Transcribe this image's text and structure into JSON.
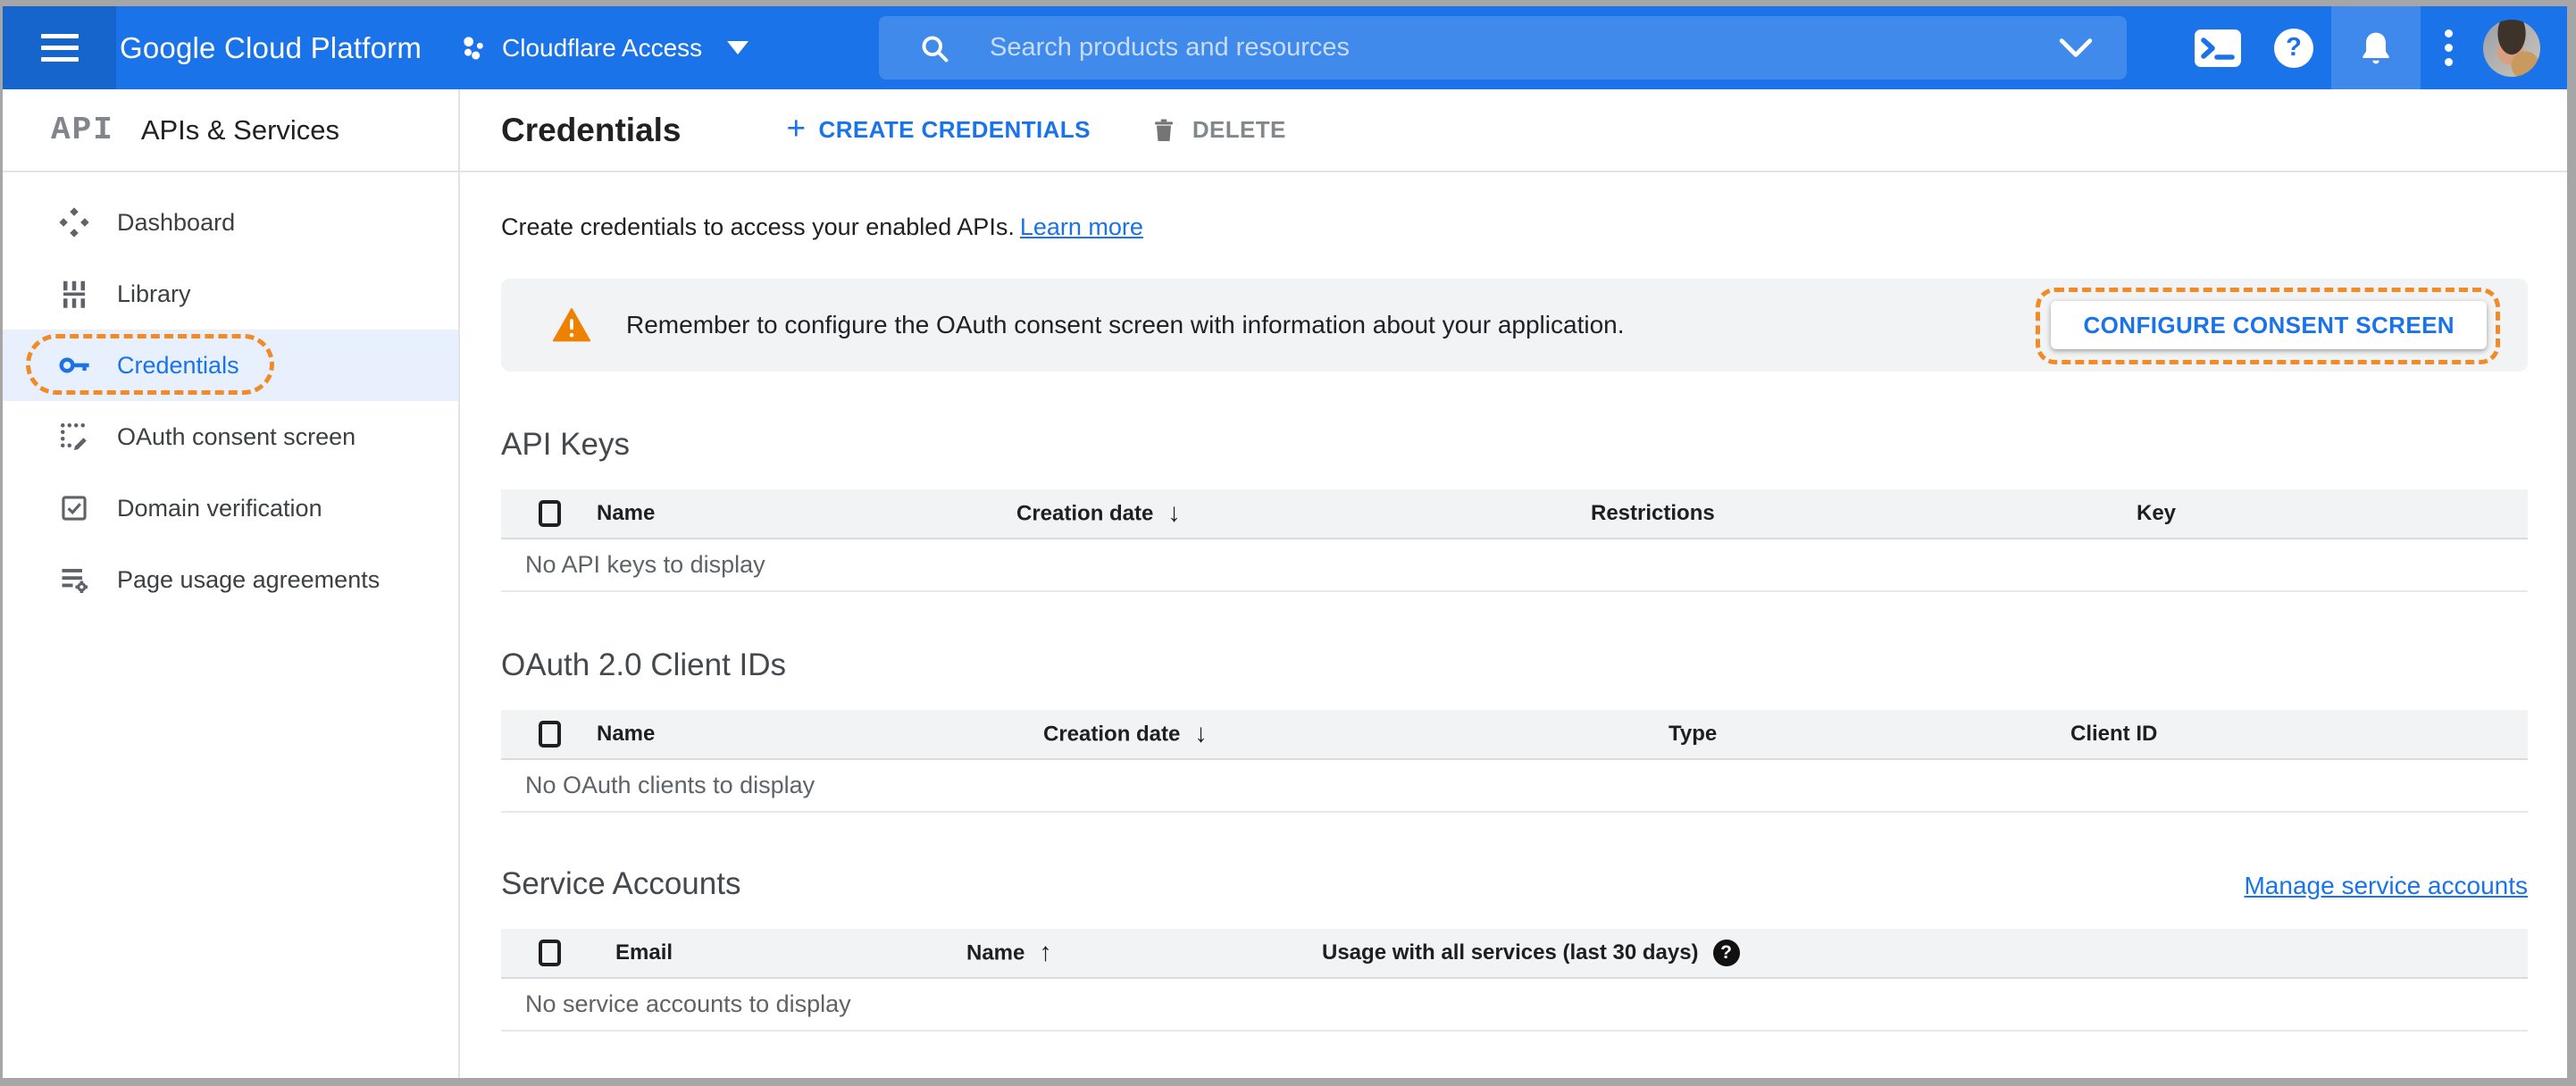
{
  "topbar": {
    "product_name": "Google Cloud Platform",
    "project_name": "Cloudflare Access",
    "search_placeholder": "Search products and resources"
  },
  "sidebar": {
    "logo_text": "API",
    "title": "APIs & Services",
    "items": [
      {
        "label": "Dashboard",
        "active": false
      },
      {
        "label": "Library",
        "active": false
      },
      {
        "label": "Credentials",
        "active": true,
        "annotated": true
      },
      {
        "label": "OAuth consent screen",
        "active": false
      },
      {
        "label": "Domain verification",
        "active": false
      },
      {
        "label": "Page usage agreements",
        "active": false
      }
    ]
  },
  "page_header": {
    "title": "Credentials",
    "create_button": "CREATE CREDENTIALS",
    "delete_button": "DELETE"
  },
  "intro": {
    "text": "Create credentials to access your enabled APIs.",
    "link": "Learn more"
  },
  "banner": {
    "message": "Remember to configure the OAuth consent screen with information about your application.",
    "button": "CONFIGURE CONSENT SCREEN"
  },
  "sections": {
    "api_keys": {
      "title": "API Keys",
      "col_name": "Name",
      "col_creation": "Creation date",
      "col_restrictions": "Restrictions",
      "col_key": "Key",
      "sort": "Creation date descending",
      "empty": "No API keys to display"
    },
    "oauth": {
      "title": "OAuth 2.0 Client IDs",
      "col_name": "Name",
      "col_creation": "Creation date",
      "col_type": "Type",
      "col_client_id": "Client ID",
      "sort": "Creation date descending",
      "empty": "No OAuth clients to display"
    },
    "service_accounts": {
      "title": "Service Accounts",
      "manage_link": "Manage service accounts",
      "col_email": "Email",
      "col_name": "Name",
      "col_usage": "Usage with all services (last 30 days)",
      "sort": "Name ascending",
      "empty": "No service accounts to display"
    }
  },
  "icons": {
    "plus": "+",
    "sort_desc": "↓",
    "sort_asc": "↑",
    "question_mark": "?"
  },
  "colors": {
    "topbar_blue": "#1a73e8",
    "accent_blue": "#1a73e8",
    "active_item_bg": "#e8f0fe",
    "annotation_orange": "#f28b26",
    "warning_orange": "#ee8100",
    "panel_gray": "#f1f3f4",
    "divider_gray": "#e3e3e3"
  }
}
